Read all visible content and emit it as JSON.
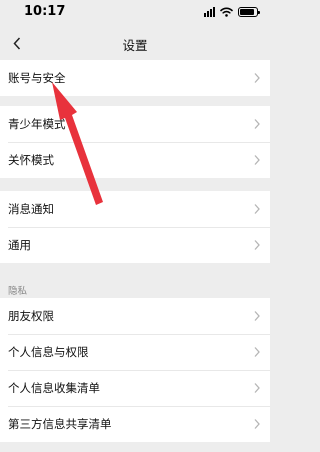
{
  "status_bar": {
    "time": "10:17"
  },
  "nav": {
    "title": "设置"
  },
  "groups": [
    {
      "items": [
        {
          "label": "账号与安全"
        }
      ]
    },
    {
      "items": [
        {
          "label": "青少年模式"
        },
        {
          "label": "关怀模式"
        }
      ]
    },
    {
      "items": [
        {
          "label": "消息通知"
        },
        {
          "label": "通用"
        }
      ]
    }
  ],
  "privacy": {
    "header": "隐私",
    "items": [
      {
        "label": "朋友权限"
      },
      {
        "label": "个人信息与权限"
      },
      {
        "label": "个人信息收集清单"
      },
      {
        "label": "第三方信息共享清单"
      }
    ]
  },
  "annotation": {
    "color": "#e8323c",
    "icon": "red-pointer-arrow"
  }
}
